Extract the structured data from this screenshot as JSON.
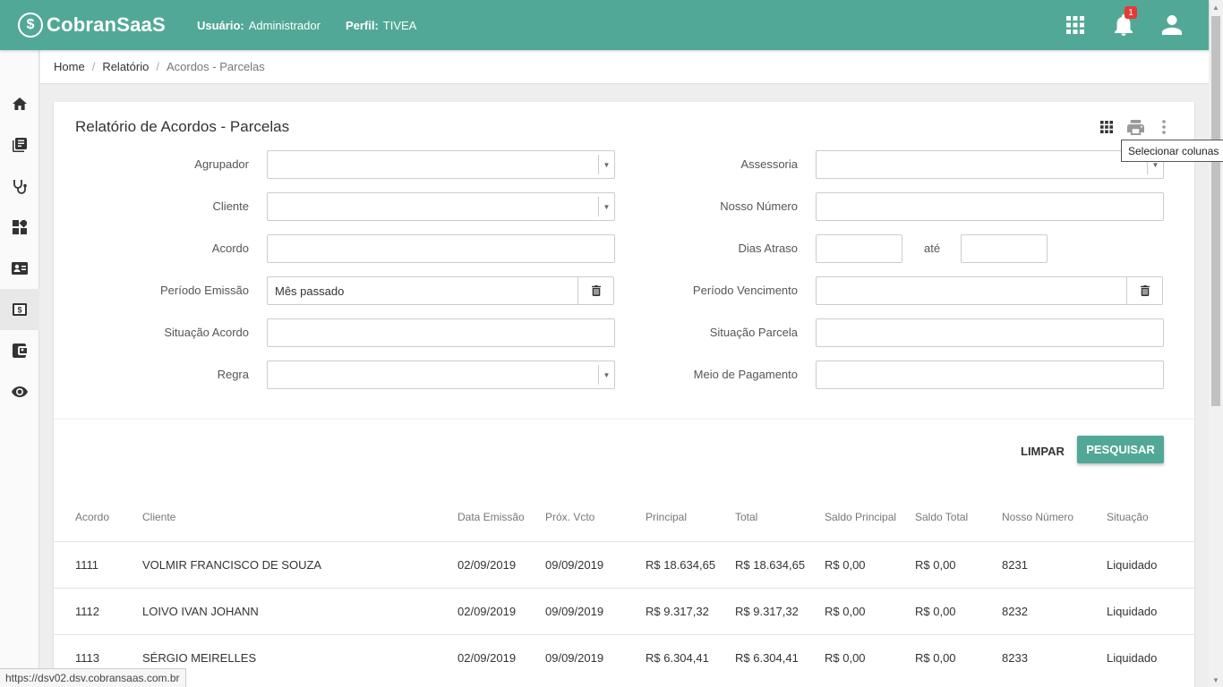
{
  "app": {
    "logo_mark": "$",
    "name": "CobranSaaS"
  },
  "header": {
    "user_label": "Usuário:",
    "user_value": "Administrador",
    "profile_label": "Perfil:",
    "profile_value": "TIVEA",
    "notification_count": "1",
    "icons": [
      "apps-icon",
      "bell-icon",
      "user-icon"
    ]
  },
  "sidebar": {
    "items": [
      {
        "icon": "home-icon"
      },
      {
        "icon": "book-icon"
      },
      {
        "icon": "stethoscope-icon"
      },
      {
        "icon": "dashboard-icon"
      },
      {
        "icon": "contact-card-icon"
      },
      {
        "icon": "money-icon",
        "active": true
      },
      {
        "icon": "wallet-icon"
      },
      {
        "icon": "eye-icon"
      }
    ]
  },
  "breadcrumb": {
    "items": [
      "Home",
      "Relatório",
      "Acordos - Parcelas"
    ]
  },
  "page": {
    "title": "Relatório de Acordos - Parcelas",
    "tooltip": "Selecionar colunas"
  },
  "form": {
    "agrupador_label": "Agrupador",
    "cliente_label": "Cliente",
    "acordo_label": "Acordo",
    "periodo_emissao_label": "Período Emissão",
    "periodo_emissao_value": "Mês passado",
    "situacao_acordo_label": "Situação Acordo",
    "regra_label": "Regra",
    "assessoria_label": "Assessoria",
    "nosso_numero_label": "Nosso Número",
    "dias_atraso_label": "Dias Atraso",
    "ate_label": "até",
    "periodo_vencimento_label": "Período Vencimento",
    "situacao_parcela_label": "Situação Parcela",
    "meio_pagamento_label": "Meio de Pagamento"
  },
  "actions": {
    "clear_label": "LIMPAR",
    "search_label": "PESQUISAR"
  },
  "table": {
    "columns": [
      "Acordo",
      "Cliente",
      "Data Emissão",
      "Próx. Vcto",
      "Principal",
      "Total",
      "Saldo Principal",
      "Saldo Total",
      "Nosso Número",
      "Situação"
    ],
    "rows": [
      [
        "1111",
        "VOLMIR FRANCISCO DE SOUZA",
        "02/09/2019",
        "09/09/2019",
        "R$ 18.634,65",
        "R$ 18.634,65",
        "R$ 0,00",
        "R$ 0,00",
        "8231",
        "Liquidado"
      ],
      [
        "1112",
        "LOIVO IVAN JOHANN",
        "02/09/2019",
        "09/09/2019",
        "R$ 9.317,32",
        "R$ 9.317,32",
        "R$ 0,00",
        "R$ 0,00",
        "8232",
        "Liquidado"
      ],
      [
        "1113",
        "SÉRGIO MEIRELLES",
        "02/09/2019",
        "09/09/2019",
        "R$ 6.304,41",
        "R$ 6.304,41",
        "R$ 0,00",
        "R$ 0,00",
        "8233",
        "Liquidado"
      ]
    ]
  },
  "statusbar": {
    "url": "https://dsv02.dsv.cobransaas.com.br"
  },
  "colors": {
    "primary": "#52a896",
    "badge": "#e53935"
  }
}
